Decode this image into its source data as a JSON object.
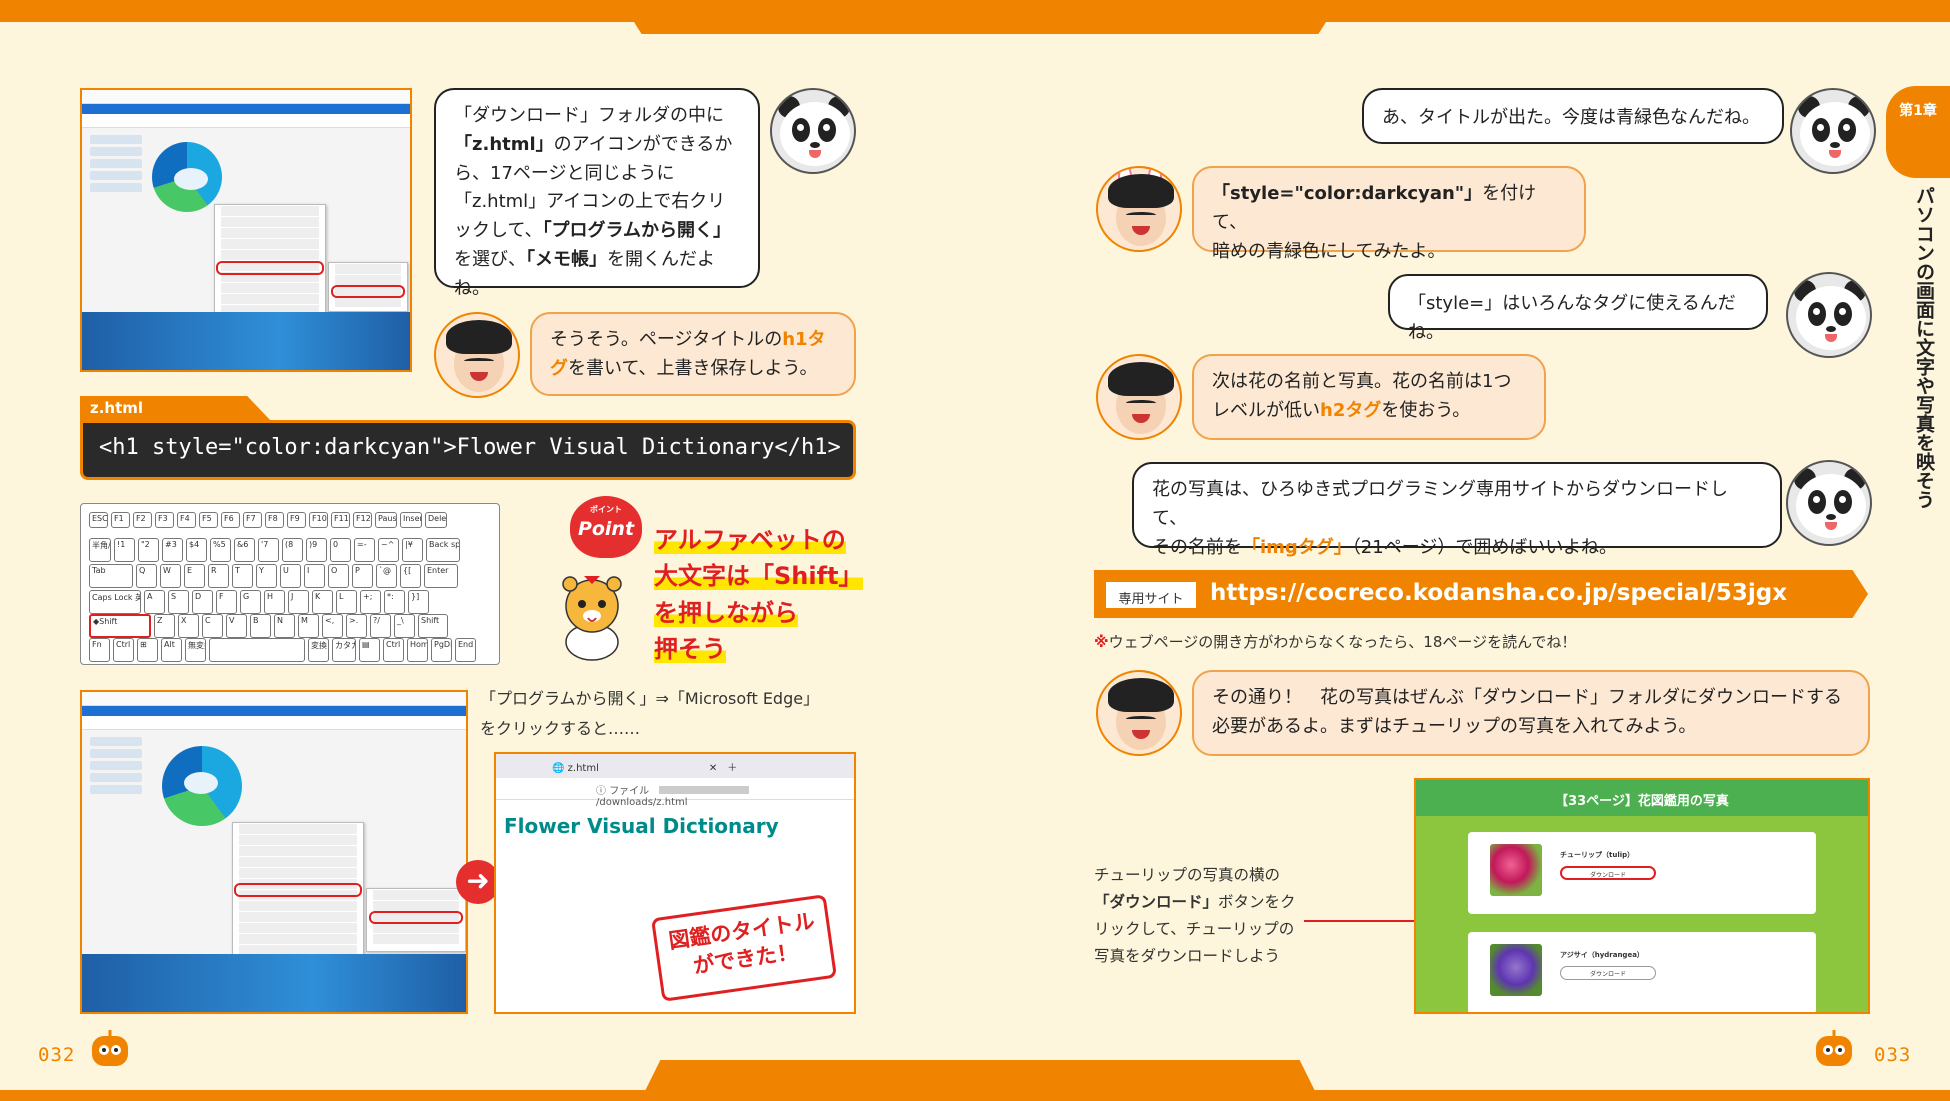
{
  "pages": {
    "left_num": "032",
    "right_num": "033"
  },
  "chapter": {
    "tab": "第1章",
    "title": "パソコンの画面に文字や写真を映そう"
  },
  "left": {
    "bubble1": {
      "p1": "「ダウンロード」フォルダの中に",
      "b1": "「z.html」",
      "p2": "のアイコンができるから、17ページと同じように「z.html」アイコンの上で右クリックして、",
      "b2": "「プログラムから開く」",
      "p3": "を選び、",
      "b3": "「メモ帳」",
      "p4": "を開くんだよね。"
    },
    "bubble2": {
      "p1": "そうそう。ページタイトルの",
      "tag": "h1タグ",
      "p2": "を書いて、上書き保存しよう。"
    },
    "code": {
      "filename": "z.html",
      "line": "<h1 style=\"color:darkcyan\">Flower Visual Dictionary</h1>"
    },
    "point": {
      "badge": "Point",
      "badge_ruby": "ポイント",
      "lines": [
        "アルファベットの",
        "大文字は「Shift」",
        "を押しながら",
        "押そう"
      ]
    },
    "keyboard": {
      "row1": [
        "ESC",
        "F1",
        "F2",
        "F3",
        "F4",
        "F5",
        "F6",
        "F7",
        "F8",
        "F9",
        "F10",
        "F11",
        "F12",
        "Pause Break",
        "Insert PrtSC",
        "Delete SysRq"
      ],
      "row2": [
        "半角/全角",
        "!1",
        "\"2",
        "#3",
        "$4",
        "%5",
        "&6",
        "'7",
        "(8",
        ")9",
        "0",
        "=-",
        "~^",
        "|¥",
        "Back space"
      ],
      "row3": [
        "Tab",
        "Q",
        "W",
        "E",
        "R",
        "T",
        "Y",
        "U",
        "I",
        "O",
        "P",
        "`@",
        "{[",
        "Enter"
      ],
      "row4": [
        "Caps Lock 英数",
        "A",
        "S",
        "D",
        "F",
        "G",
        "H",
        "J",
        "K",
        "L",
        "+;",
        "*:",
        "}]"
      ],
      "row5": [
        "◆Shift",
        "Z",
        "X",
        "C",
        "V",
        "B",
        "N",
        "M",
        "<,",
        ">.",
        "?/",
        "_\\",
        "Shift"
      ],
      "row6": [
        "Fn",
        "Ctrl",
        "⊞",
        "Alt",
        "無変換",
        "",
        "変換",
        "カタカナ ひらがな",
        "▤",
        "Ctrl",
        "Home",
        "PgDn",
        "End"
      ]
    },
    "caption": {
      "line1": "「プログラムから開く」⇒「Microsoft Edge」",
      "line2": "をクリックすると……"
    },
    "browser": {
      "tab": "z.html",
      "address": "ファイル",
      "path": "/downloads/z.html",
      "heading": "Flower Visual Dictionary"
    },
    "stamp": {
      "line1": "図鑑のタイトル",
      "line2": "ができた！"
    }
  },
  "right": {
    "b1": "あ、タイトルが出た。今度は青緑色なんだね。",
    "b2": {
      "bold": "「style=\"color:darkcyan\"」",
      "p1": "を付けて、",
      "p2": "暗めの青緑色にしてみたよ。"
    },
    "b3": "「style=」はいろんなタグに使えるんだね。",
    "b4": {
      "p1": "次は花の名前と写真。花の名前は1つ",
      "p2": "レベルが低い",
      "tag": "h2タグ",
      "p3": "を使おう。"
    },
    "b5": {
      "p1": "花の写真は、ひろゆき式プログラミング専用サイトからダウンロードして、",
      "p2": "その名前を",
      "tag": "「imgタグ」",
      "p3": "（21ページ）で囲めばいいよね。"
    },
    "url": {
      "label": "専用サイト",
      "href": "https://cocreco.kodansha.co.jp/special/53jgx"
    },
    "note": {
      "mark": "※",
      "text": "ウェブページの開き方がわからなくなったら、18ページを読んでね！"
    },
    "b6": {
      "p1": "その通り！　花の写真はぜんぶ「ダウンロード」フォルダにダウンロードする",
      "p2": "必要があるよ。まずはチューリップの写真を入れてみよう。"
    },
    "gallery": {
      "header": "【33ページ】花図鑑用の写真",
      "cards": [
        {
          "name": "チューリップ（tulip）",
          "button": "ダウンロード"
        },
        {
          "name": "アジサイ（hydrangea）",
          "button": "ダウンロード"
        }
      ]
    },
    "side_caption": {
      "p1": "チューリップの写真の横の",
      "bold": "「ダウンロード」",
      "p2": "ボタンをクリックして、チューリップの写真をダウンロードしよう"
    }
  }
}
